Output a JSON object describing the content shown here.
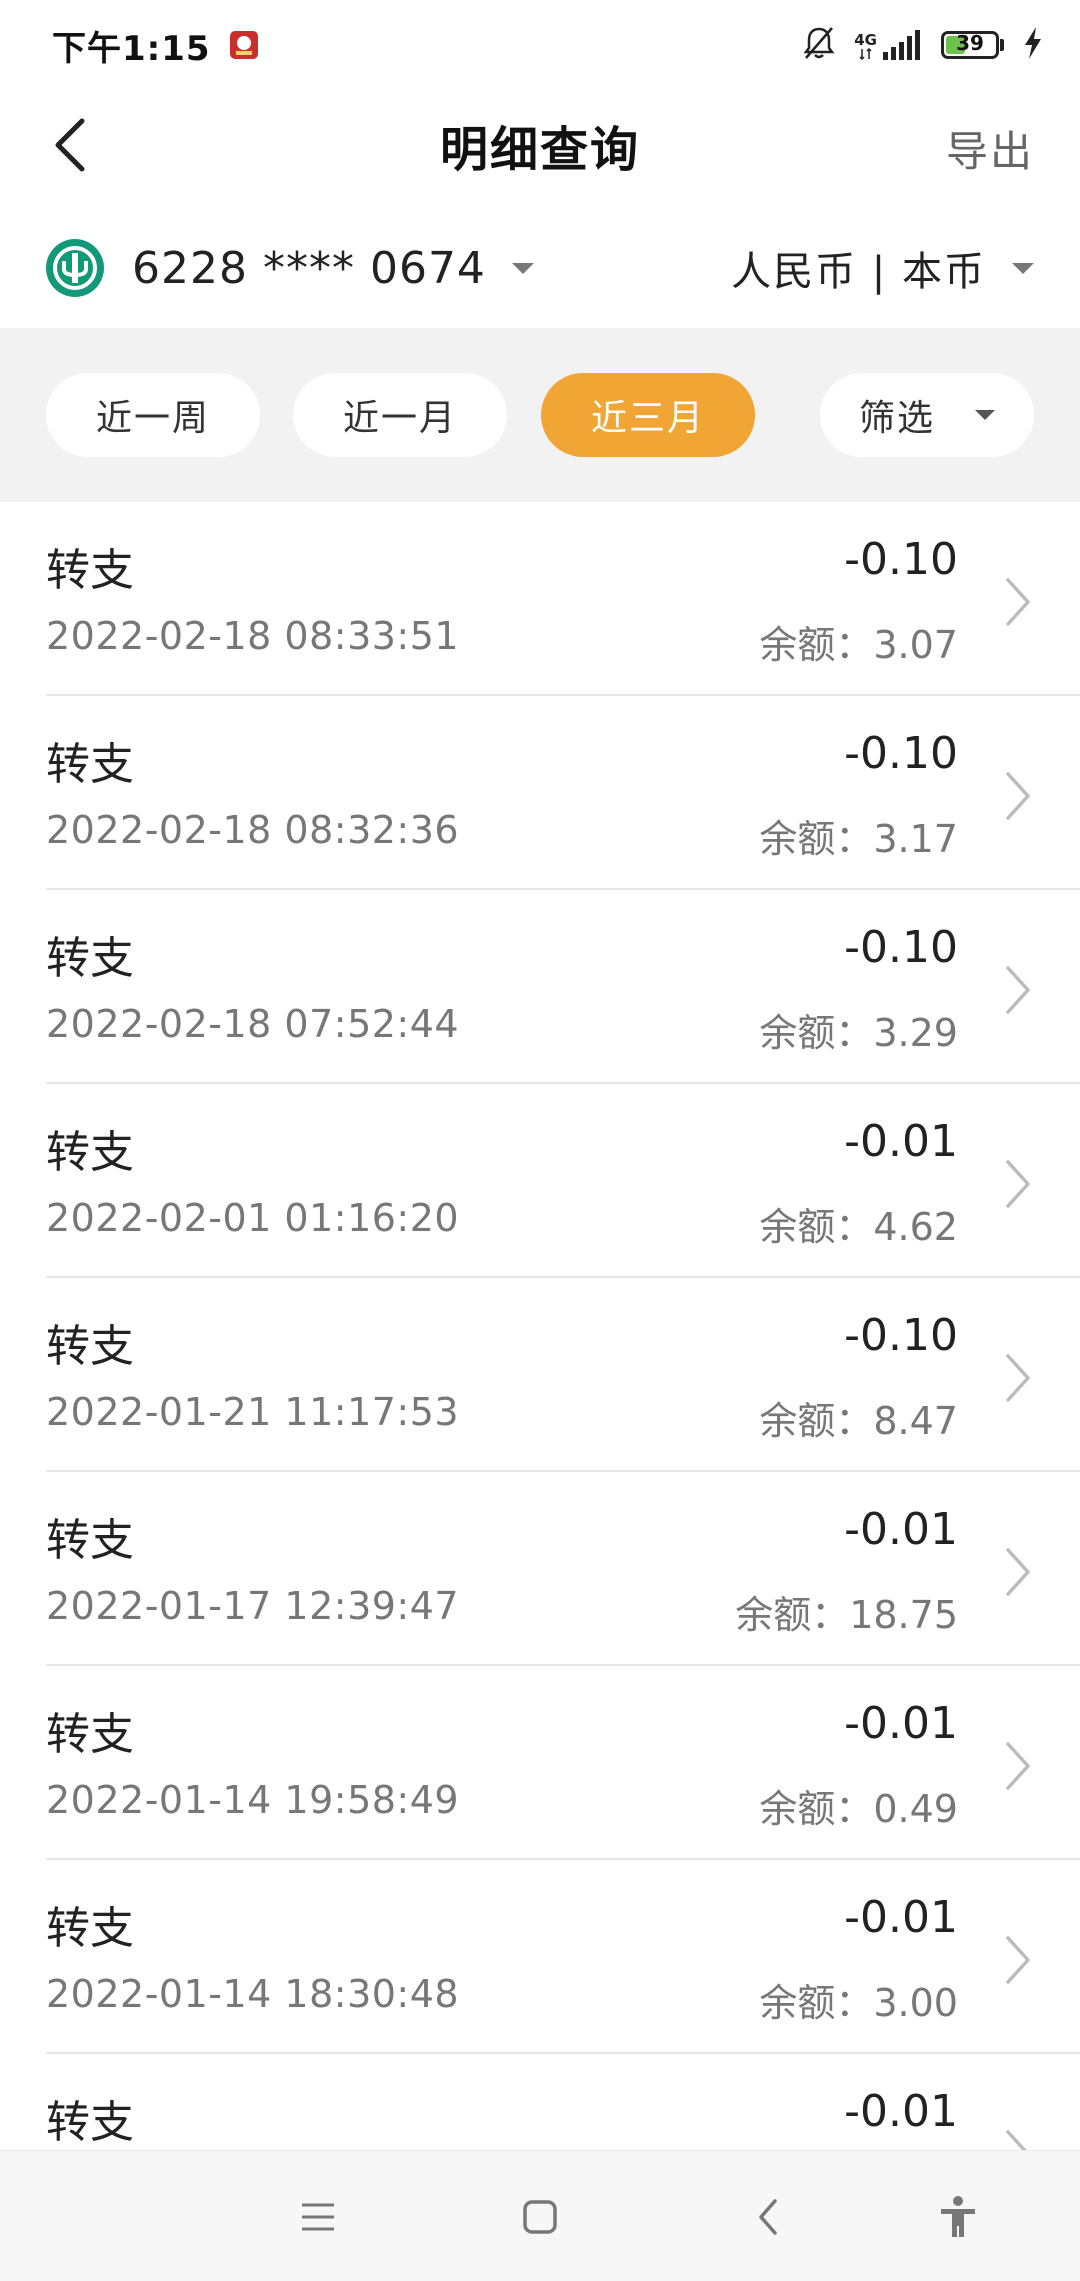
{
  "status_bar": {
    "time": "下午1:15",
    "network": "4G",
    "battery": "39",
    "battery_level": 0.39,
    "icons": [
      "app-notification-icon",
      "mute-bell-icon",
      "signal-icon",
      "battery-icon",
      "charging-icon"
    ]
  },
  "header": {
    "title": "明细查询",
    "export_label": "导出",
    "back_icon": "back-arrow-icon"
  },
  "account": {
    "number": "6228 **** 0674",
    "currency": "人民币 | 本币",
    "logo_icon": "bank-logo-icon"
  },
  "filters": {
    "chips": [
      {
        "label": "近一周",
        "active": false
      },
      {
        "label": "近一月",
        "active": false
      },
      {
        "label": "近三月",
        "active": true
      },
      {
        "label": "筛选",
        "active": false
      }
    ],
    "active_color": "#f0a535"
  },
  "transactions": [
    {
      "type": "转支",
      "datetime": "2022-02-18 08:33:51",
      "amount": "-0.10",
      "balance": "余额：3.07"
    },
    {
      "type": "转支",
      "datetime": "2022-02-18 08:32:36",
      "amount": "-0.10",
      "balance": "余额：3.17"
    },
    {
      "type": "转支",
      "datetime": "2022-02-18 07:52:44",
      "amount": "-0.10",
      "balance": "余额：3.29"
    },
    {
      "type": "转支",
      "datetime": "2022-02-01 01:16:20",
      "amount": "-0.01",
      "balance": "余额：4.62"
    },
    {
      "type": "转支",
      "datetime": "2022-01-21 11:17:53",
      "amount": "-0.10",
      "balance": "余额：8.47"
    },
    {
      "type": "转支",
      "datetime": "2022-01-17 12:39:47",
      "amount": "-0.01",
      "balance": "余额：18.75"
    },
    {
      "type": "转支",
      "datetime": "2022-01-14 19:58:49",
      "amount": "-0.01",
      "balance": "余额：0.49"
    },
    {
      "type": "转支",
      "datetime": "2022-01-14 18:30:48",
      "amount": "-0.01",
      "balance": "余额：3.00"
    },
    {
      "type": "转支",
      "datetime": "",
      "amount": "-0.01",
      "balance": ""
    }
  ],
  "nav_bar": {
    "icons": [
      "menu-icon",
      "home-square-icon",
      "back-icon",
      "accessibility-icon"
    ]
  }
}
